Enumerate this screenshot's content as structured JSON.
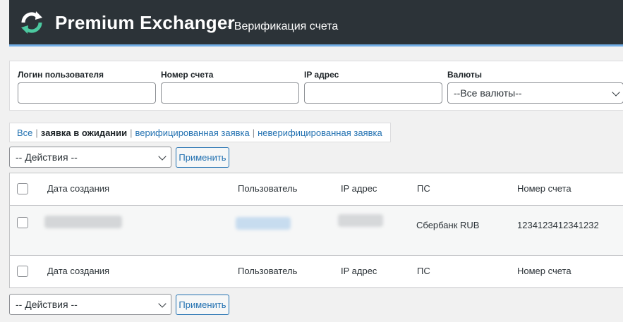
{
  "header": {
    "brand": "Premium Exchanger",
    "subtitle": "- Верификация счета"
  },
  "filters": {
    "login_label": "Логин пользователя",
    "account_label": "Номер счета",
    "ip_label": "IP адрес",
    "currency_label": "Валюты",
    "currency_selected": "--Все валюты--"
  },
  "views": {
    "all": "Все",
    "pending": "заявка в ожидании",
    "verified": "верифицированная заявка",
    "unverified": "неверифицированная заявка"
  },
  "bulk": {
    "action_selected": "-- Действия --",
    "apply": "Применить"
  },
  "table": {
    "columns": [
      "Дата создания",
      "Пользователь",
      "IP адрес",
      "ПС",
      "Номер счета"
    ],
    "rows": [
      {
        "ps": "Сбербанк RUB",
        "account": "1234123412341232"
      }
    ]
  },
  "colors": {
    "header_bg": "#2c3338",
    "accent": "#72aee6",
    "link": "#2271b1"
  },
  "icons": {
    "logo": "refresh-arrows-icon",
    "dropdown": "chevron-down-icon"
  }
}
